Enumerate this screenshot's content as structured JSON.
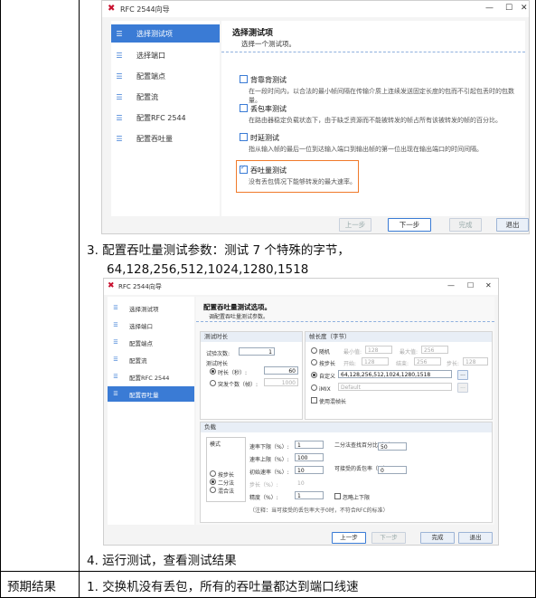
{
  "window1": {
    "title": "RFC 2544向导",
    "controls": {
      "minimize": "—",
      "maximize": "☐",
      "close": "✕"
    },
    "sidebar": [
      {
        "label": "选择测试项",
        "selected": true
      },
      {
        "label": "选择端口",
        "selected": false
      },
      {
        "label": "配置端点",
        "selected": false
      },
      {
        "label": "配置流",
        "selected": false
      },
      {
        "label": "配置RFC 2544",
        "selected": false
      },
      {
        "label": "配置吞吐量",
        "selected": false
      }
    ],
    "heading": "选择测试项",
    "subheading": "选择一个测试项。",
    "options": [
      {
        "title": "背靠背测试",
        "desc": "在一段时间内，以合法的最小帧间隔在传输介质上连续发送固定长度的包而不引起包丢时的包数量。",
        "checked": false
      },
      {
        "title": "丢包率测试",
        "desc": "在路由器稳定负载状态下，由于缺乏资源而不能被转发的帧占所有该被转发的帧的百分比。",
        "checked": false
      },
      {
        "title": "时延测试",
        "desc": "指从输入帧的最后一位到达输入端口到输出帧的第一位出现在输出端口的时间间隔。",
        "checked": false
      },
      {
        "title": "吞吐量测试",
        "desc": "没有丢包情况下能够转发的最大速率。",
        "checked": true
      }
    ],
    "buttons": {
      "prev": "上一步",
      "next": "下一步",
      "finish": "完成",
      "exit": "退出"
    }
  },
  "step3_line1": "3.  配置吞吐量测试参数：测试 7 个特殊的字节，",
  "step3_line2": "64,128,256,512,1024,1280,1518",
  "window2": {
    "title": "RFC 2544向导",
    "controls": {
      "minimize": "—",
      "maximize": "☐",
      "close": "✕"
    },
    "sidebar": [
      {
        "label": "选择测试项",
        "selected": false
      },
      {
        "label": "选择端口",
        "selected": false
      },
      {
        "label": "配置端点",
        "selected": false
      },
      {
        "label": "配置流",
        "selected": false
      },
      {
        "label": "配置RFC 2544",
        "selected": false
      },
      {
        "label": "配置吞吐量",
        "selected": true
      }
    ],
    "heading": "配置吞吐量测试选项。",
    "subheading": "调配置吞吐量测试参数。",
    "duration": {
      "title": "测试时长",
      "trials_label": "试验次数:",
      "trials_value": "1",
      "duration_label": "测试时长",
      "time_label": "时长（秒）:",
      "time_value": "60",
      "frames_label": "突发个数（帧）:",
      "frames_value": "1000"
    },
    "framesize": {
      "title": "帧长度（字节）",
      "random_label": "随机",
      "min_label": "最小值:",
      "min_value": "128",
      "max_label": "最大值:",
      "max_value": "256",
      "step_label": "按步长",
      "start_label": "开始:",
      "start_value": "128",
      "end_label": "结束:",
      "end_value": "256",
      "stepsize_label": "步长:",
      "stepsize_value": "128",
      "custom_label": "自定义",
      "custom_value": "64,128,256,512,1024,1280,1518",
      "imix_label": "iMIX",
      "imix_value": "Default",
      "mixed_label": "使用混帧长",
      "more_btn": "..."
    },
    "load": {
      "title": "负载",
      "mode_label": "模式",
      "modes": [
        "按步长",
        "二分法",
        "混合法"
      ],
      "rate_low_label": "速率下限（%）:",
      "rate_low_value": "1",
      "rate_high_label": "速率上限（%）:",
      "rate_high_value": "100",
      "init_rate_label": "初始速率（%）:",
      "init_rate_value": "10",
      "step_label": "步长（%）:",
      "step_value": "10",
      "precision_label": "精度（%）:",
      "precision_value": "1",
      "binary_label": "二分法查找百分比（%）:",
      "binary_value": "50",
      "loss_label": "可接受的丢包率（%）:",
      "loss_value": "0",
      "rounding_label": "忽略上下限",
      "note": "（注释：当可接受的丢包率大于0时，不符合RFC的标准）"
    },
    "buttons": {
      "prev": "上一步",
      "next": "下一步",
      "finish": "完成",
      "exit": "退出"
    }
  },
  "step4": "4.  运行测试，查看测试结果",
  "expected_label": "预期结果",
  "expected_text": "1.  交换机没有丢包，所有的吞吐量都达到端口线速"
}
